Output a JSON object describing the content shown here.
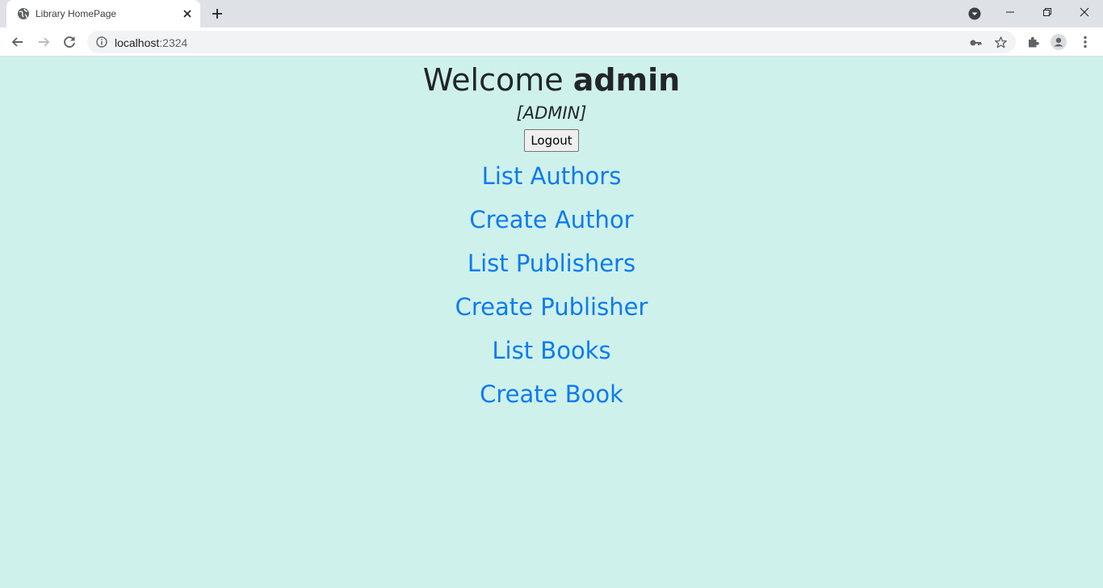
{
  "browser": {
    "tab_title": "Library HomePage",
    "url_host": "localhost",
    "url_port": ":2324"
  },
  "page": {
    "welcome_prefix": "Welcome ",
    "username": "admin",
    "role": "[ADMIN]",
    "logout_label": "Logout",
    "links": [
      {
        "label": "List Authors"
      },
      {
        "label": "Create Author"
      },
      {
        "label": "List Publishers"
      },
      {
        "label": "Create Publisher"
      },
      {
        "label": "List Books"
      },
      {
        "label": "Create Book"
      }
    ]
  },
  "colors": {
    "page_background": "#cff1ec",
    "link": "#0d7bf0",
    "text": "#212529"
  }
}
